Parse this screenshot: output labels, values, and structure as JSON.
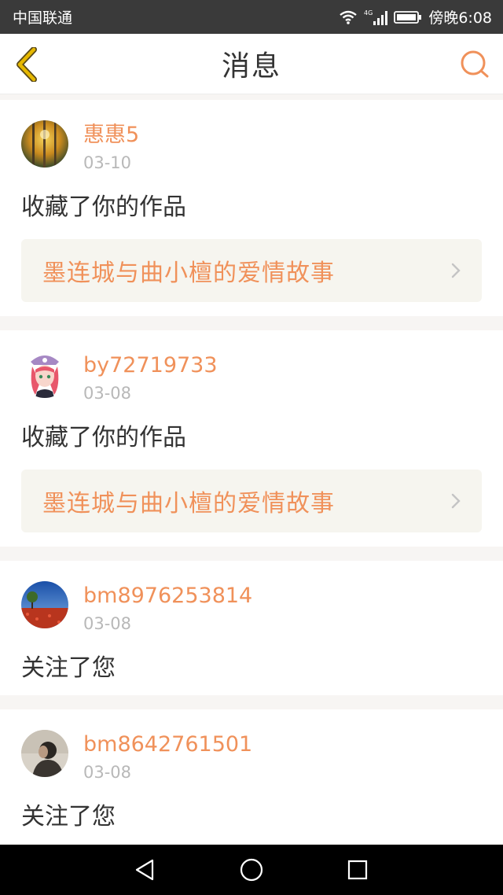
{
  "status_bar": {
    "carrier": "中国联通",
    "network": "4G",
    "time": "傍晚6:08"
  },
  "header": {
    "title": "消息",
    "back_icon": "chevron-left-icon",
    "search_icon": "search-icon"
  },
  "colors": {
    "accent": "#f0915a",
    "back_icon": "#e6b800",
    "status_bar_bg": "#3a3a3a",
    "nav_bar_bg": "#000000",
    "work_link_bg": "#f6f5ef"
  },
  "messages": [
    {
      "username": "惠惠5",
      "date": "03-10",
      "action": "收藏了你的作品",
      "work_title": "墨连城与曲小檀的爱情故事",
      "avatar": "autumn-forest-avatar"
    },
    {
      "username": "by72719733",
      "date": "03-08",
      "action": "收藏了你的作品",
      "work_title": "墨连城与曲小檀的爱情故事",
      "avatar": "anime-girl-avatar"
    },
    {
      "username": "bm8976253814",
      "date": "03-08",
      "action": "关注了您",
      "avatar": "poppy-field-avatar"
    },
    {
      "username": "bm8642761501",
      "date": "03-08",
      "action": "关注了您",
      "avatar": "person-photo-avatar"
    }
  ],
  "nav_bar": {
    "back_icon": "triangle-back-icon",
    "home_icon": "circle-home-icon",
    "recents_icon": "square-recents-icon"
  }
}
